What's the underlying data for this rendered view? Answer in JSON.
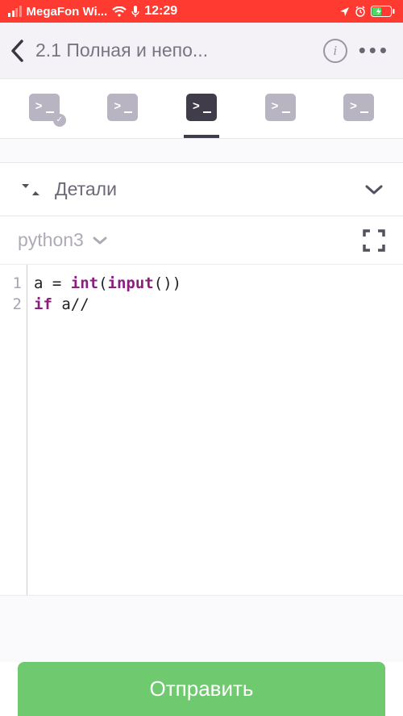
{
  "status": {
    "carrier": "MegaFon Wi...",
    "time": "12:29"
  },
  "header": {
    "title": "2.1 Полная и непо..."
  },
  "details": {
    "label": "Детали"
  },
  "lang": {
    "selected": "python3"
  },
  "code": {
    "lines": [
      "1",
      "2"
    ],
    "line1_a": "a = ",
    "line1_b": "int",
    "line1_c": "(",
    "line1_d": "input",
    "line1_e": "())",
    "line2_a": "if",
    "line2_b": " a//"
  },
  "submit": {
    "label": "Отправить"
  }
}
